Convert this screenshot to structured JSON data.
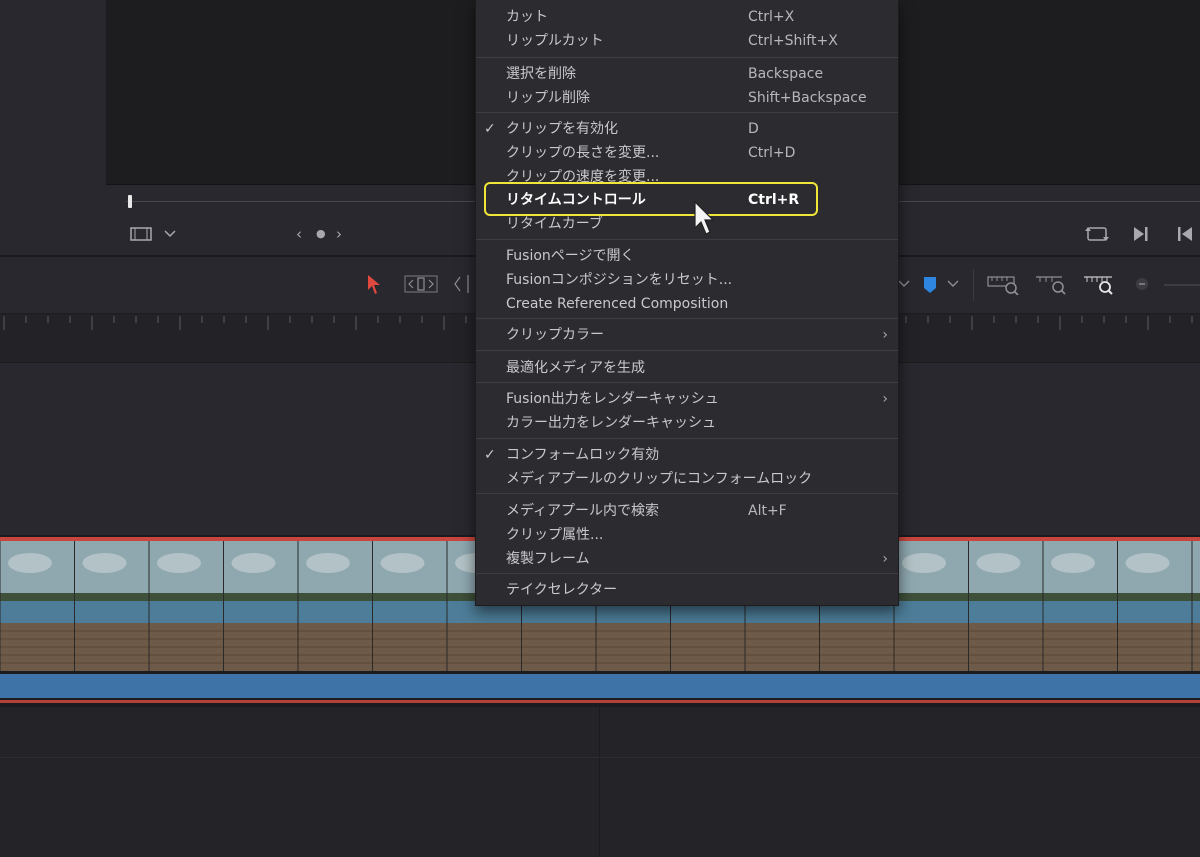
{
  "menu": {
    "items": [
      {
        "label": "カット",
        "shortcut": "Ctrl+X",
        "checked": false,
        "submenu": false
      },
      {
        "label": "リップルカット",
        "shortcut": "Ctrl+Shift+X",
        "checked": false,
        "submenu": false
      },
      {
        "label": "選択を削除",
        "shortcut": "Backspace",
        "checked": false,
        "submenu": false
      },
      {
        "label": "リップル削除",
        "shortcut": "Shift+Backspace",
        "checked": false,
        "submenu": false
      },
      {
        "label": "クリップを有効化",
        "shortcut": "D",
        "checked": true,
        "submenu": false
      },
      {
        "label": "クリップの長さを変更...",
        "shortcut": "Ctrl+D",
        "checked": false,
        "submenu": false
      },
      {
        "label": "クリップの速度を変更...",
        "shortcut": "",
        "checked": false,
        "submenu": false
      },
      {
        "label": "リタイムコントロール",
        "shortcut": "Ctrl+R",
        "checked": false,
        "submenu": false,
        "highlighted": true
      },
      {
        "label": "リタイムカーブ",
        "shortcut": "",
        "checked": false,
        "submenu": false
      },
      {
        "label": "Fusionページで開く",
        "shortcut": "",
        "checked": false,
        "submenu": false
      },
      {
        "label": "Fusionコンポジションをリセット...",
        "shortcut": "",
        "checked": false,
        "submenu": false
      },
      {
        "label": "Create Referenced Composition",
        "shortcut": "",
        "checked": false,
        "submenu": false
      },
      {
        "label": "クリップカラー",
        "shortcut": "",
        "checked": false,
        "submenu": true
      },
      {
        "label": "最適化メディアを生成",
        "shortcut": "",
        "checked": false,
        "submenu": false
      },
      {
        "label": "Fusion出力をレンダーキャッシュ",
        "shortcut": "",
        "checked": false,
        "submenu": true
      },
      {
        "label": "カラー出力をレンダーキャッシュ",
        "shortcut": "",
        "checked": false,
        "submenu": false
      },
      {
        "label": "コンフォームロック有効",
        "shortcut": "",
        "checked": true,
        "submenu": false
      },
      {
        "label": "メディアプールのクリップにコンフォームロック",
        "shortcut": "",
        "checked": false,
        "submenu": false
      },
      {
        "label": "メディアプール内で検索",
        "shortcut": "Alt+F",
        "checked": false,
        "submenu": false
      },
      {
        "label": "クリップ属性...",
        "shortcut": "",
        "checked": false,
        "submenu": false
      },
      {
        "label": "複製フレーム",
        "shortcut": "",
        "checked": false,
        "submenu": true
      },
      {
        "label": "テイクセレクター",
        "shortcut": "",
        "checked": false,
        "submenu": false
      }
    ],
    "check_glyph": "✓",
    "submenu_glyph": "›"
  },
  "viewer": {
    "nav_prev": "‹",
    "nav_dot": "●",
    "nav_next": "›",
    "icons": [
      "filmstrip-icon",
      "chevron-down-icon",
      "loop-icon",
      "next-clip-icon",
      "first-frame-icon"
    ]
  },
  "toolbar": {
    "icons": [
      "selection-arrow-icon",
      "trim-icon",
      "blade-icon",
      "flag-icon",
      "marker-icon",
      "zoom-full-icon",
      "zoom-detail-icon",
      "zoom-custom-icon",
      "zoom-out-icon"
    ]
  },
  "colors": {
    "highlight_ring": "#f0e63a",
    "clip_border": "#c9463f",
    "audio_track": "#3e73a7",
    "marker": "#2f86e0",
    "selection_arrow": "#e0483e"
  }
}
